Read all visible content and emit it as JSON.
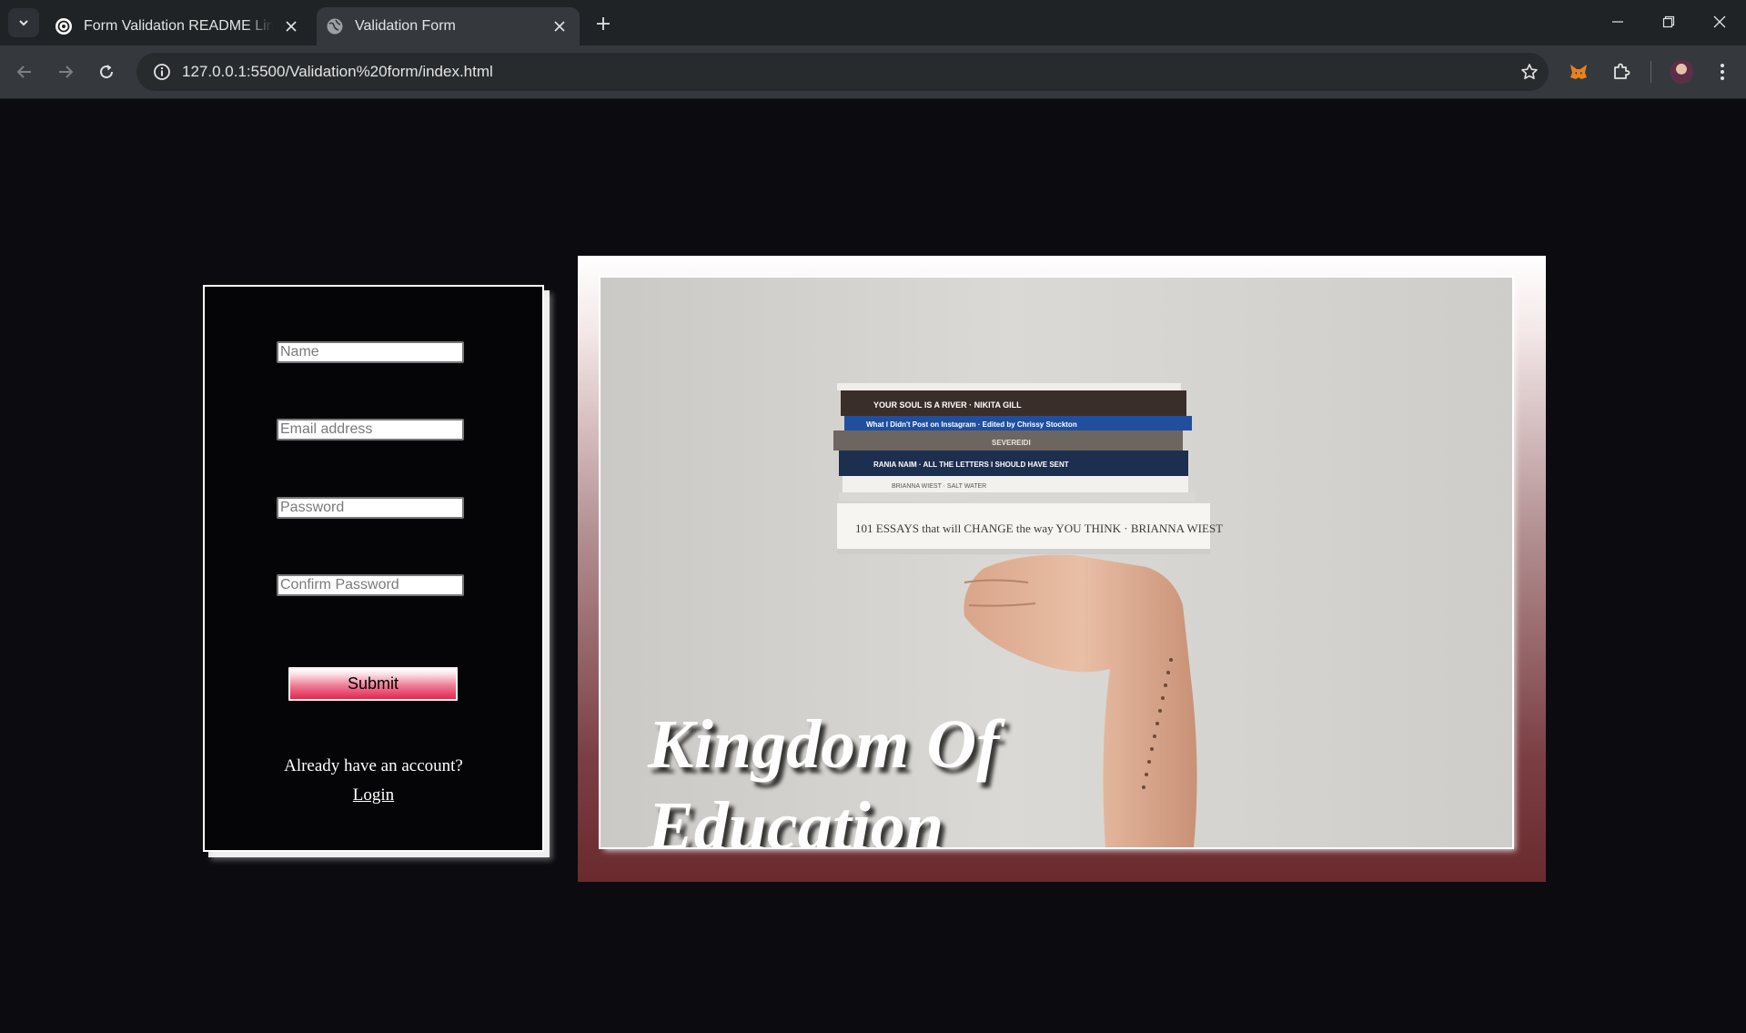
{
  "browser": {
    "tabs": [
      {
        "title": "Form Validation README LinkedIn",
        "active": false
      },
      {
        "title": "Validation Form",
        "active": true
      }
    ],
    "url": "127.0.0.1:5500/Validation%20form/index.html"
  },
  "form": {
    "name_placeholder": "Name",
    "email_placeholder": "Email address",
    "password_placeholder": "Password",
    "confirm_placeholder": "Confirm Password",
    "submit_label": "Submit",
    "already_text": "Already have an account?",
    "login_label": "Login"
  },
  "hero": {
    "title_line1": "Kingdom Of",
    "title_line2": "Education",
    "book_spines": [
      "YOUR SOUL IS A RIVER · NIKITA GILL",
      "What I Didn't Post on Instagram · Edited by Chrissy Stockton",
      "SEVEREIDI",
      "RANIA NAIM · ALL THE LETTERS I SHOULD HAVE SENT",
      "BRIANNA WIEST · SALT WATER",
      "101 ESSAYS that will CHANGE the way YOU THINK · BRIANNA WIEST"
    ]
  },
  "colors": {
    "page_bg": "#0b0b10",
    "submit_accent": "#e0274f",
    "hero_frame_bottom": "#6a2a2e"
  }
}
